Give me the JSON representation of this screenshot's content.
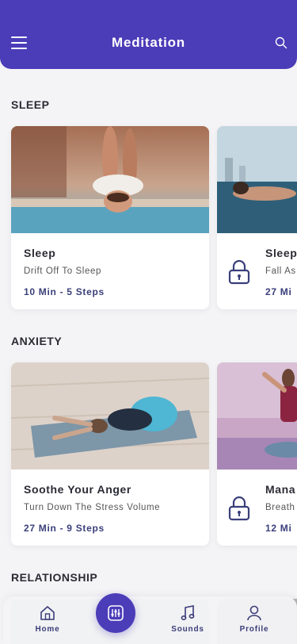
{
  "header": {
    "title": "Meditation",
    "menu_icon": "hamburger-menu-icon",
    "search_icon": "search-icon"
  },
  "sections": [
    {
      "title": "SLEEP",
      "cards": [
        {
          "title": "Sleep",
          "subtitle": "Drift Off To Sleep",
          "steps": "10 Min - 5 Steps",
          "locked": false
        },
        {
          "title": "Sleep",
          "subtitle": "Fall As",
          "steps": "27 Mi",
          "locked": true
        }
      ]
    },
    {
      "title": "ANXIETY",
      "cards": [
        {
          "title": "Soothe Your Anger",
          "subtitle": "Turn Down The Stress Volume",
          "steps": "27 Min - 9 Steps",
          "locked": false
        },
        {
          "title": "Mana",
          "subtitle": "Breath",
          "steps": "12 Mi",
          "locked": true
        }
      ]
    },
    {
      "title": "RELATIONSHIP"
    }
  ],
  "nav": {
    "home": "Home",
    "sounds": "Sounds",
    "profile": "Profile",
    "fab_icon": "equalizer-icon"
  },
  "colors": {
    "primary": "#4b3cb8",
    "accent_text": "#3a3f7a",
    "background": "#f4f4f6"
  }
}
